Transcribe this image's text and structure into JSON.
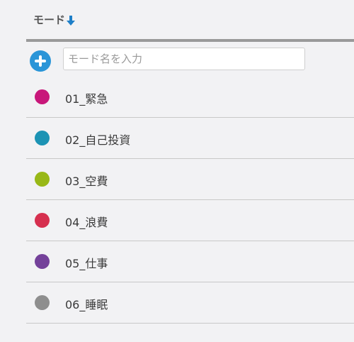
{
  "header": {
    "title": "モード",
    "sort_icon": "arrow-down-icon",
    "sort_color": "#1e7fc8"
  },
  "add_row": {
    "add_icon": "plus-circle-icon",
    "add_color": "#2a95d8",
    "input_value": "",
    "input_placeholder": "モード名を入力"
  },
  "modes": [
    {
      "label": "01_緊急",
      "color": "#c8177a"
    },
    {
      "label": "02_自己投資",
      "color": "#1c93b4"
    },
    {
      "label": "03_空費",
      "color": "#98b817"
    },
    {
      "label": "04_浪費",
      "color": "#d6304f"
    },
    {
      "label": "05_仕事",
      "color": "#74419a"
    },
    {
      "label": "06_睡眠",
      "color": "#8e8e8e"
    }
  ]
}
